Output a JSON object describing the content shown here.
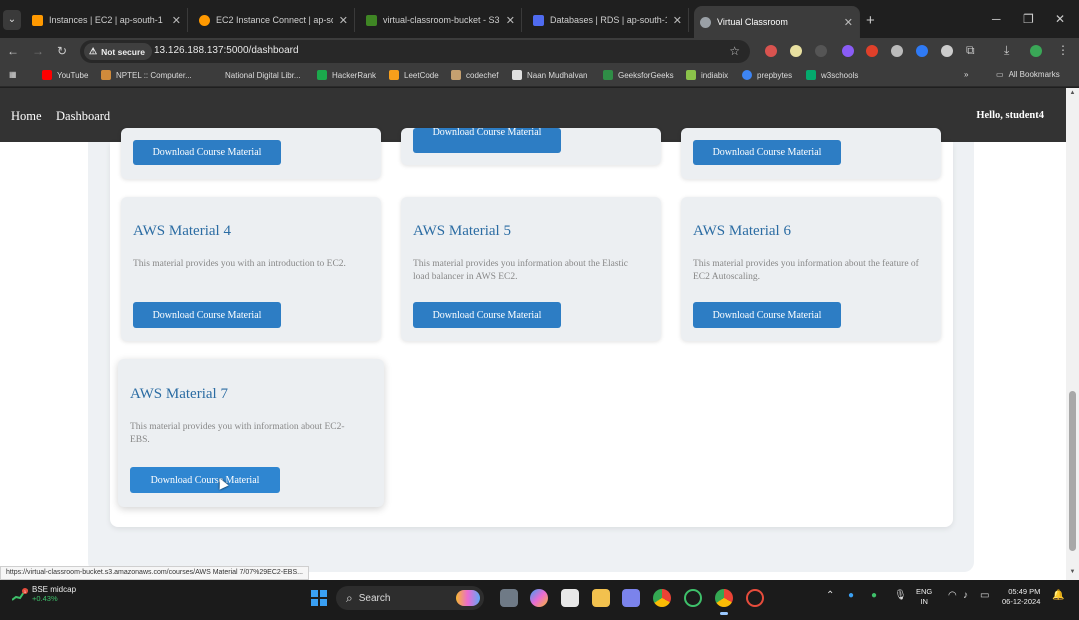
{
  "browser": {
    "tabs": [
      {
        "title": "Instances | EC2 | ap-south-1",
        "icon": "aws-ec2-icon",
        "color": "#ff9900"
      },
      {
        "title": "EC2 Instance Connect | ap-sout",
        "icon": "aws-ec2-connect-icon",
        "color": "#ff9900"
      },
      {
        "title": "virtual-classroom-bucket - S3 b",
        "icon": "aws-s3-icon",
        "color": "#3f8624"
      },
      {
        "title": "Databases | RDS | ap-south-1",
        "icon": "aws-rds-icon",
        "color": "#4f6bf0"
      },
      {
        "title": "Virtual Classroom",
        "icon": "globe-icon",
        "color": "#9aa0a6",
        "active": true
      }
    ],
    "security_label": "Not secure",
    "url": "13.126.188.137:5000/dashboard",
    "bookmarks": [
      {
        "label": "YouTube",
        "color": "#ff0000"
      },
      {
        "label": "NPTEL :: Computer...",
        "color": "#d08b3b"
      },
      {
        "label": "National Digital Libr...",
        "color": "#3c3c3c"
      },
      {
        "label": "HackerRank",
        "color": "#1ba94c"
      },
      {
        "label": "LeetCode",
        "color": "#f89f1b"
      },
      {
        "label": "codechef",
        "color": "#c5a070"
      },
      {
        "label": "Naan Mudhalvan",
        "color": "#e0e0e0"
      },
      {
        "label": "GeeksforGeeks",
        "color": "#2f8d46"
      },
      {
        "label": "indiabix",
        "color": "#8bc34a"
      },
      {
        "label": "prepbytes",
        "color": "#3d85f5"
      },
      {
        "label": "w3schools",
        "color": "#04aa6d"
      }
    ],
    "all_bookmarks_label": "All Bookmarks",
    "status_url": "https://virtual-classroom-bucket.s3.amazonaws.com/courses/AWS Material 7/07%29EC2-EBS..."
  },
  "site": {
    "nav": {
      "home": "Home",
      "dashboard": "Dashboard",
      "greeting": "Hello, student4"
    },
    "download_label": "Download Course Material",
    "partial_download_label": "Download Course Material",
    "materials": [
      {
        "title": "AWS Material 4",
        "description": "This material provides you with an introduction to EC2."
      },
      {
        "title": "AWS Material 5",
        "description": "This material provides you information about the Elastic load balancer in AWS EC2."
      },
      {
        "title": "AWS Material 6",
        "description": "This material provides you information about the feature of EC2 Autoscaling."
      },
      {
        "title": "AWS Material 7",
        "description": "This material provides you with information about EC2-EBS."
      }
    ]
  },
  "taskbar": {
    "market_name": "BSE midcap",
    "market_change": "+0.43%",
    "search_label": "Search",
    "lang_top": "ENG",
    "lang_bottom": "IN",
    "time": "05:49 PM",
    "date": "06-12-2024",
    "notification_count": "1"
  }
}
